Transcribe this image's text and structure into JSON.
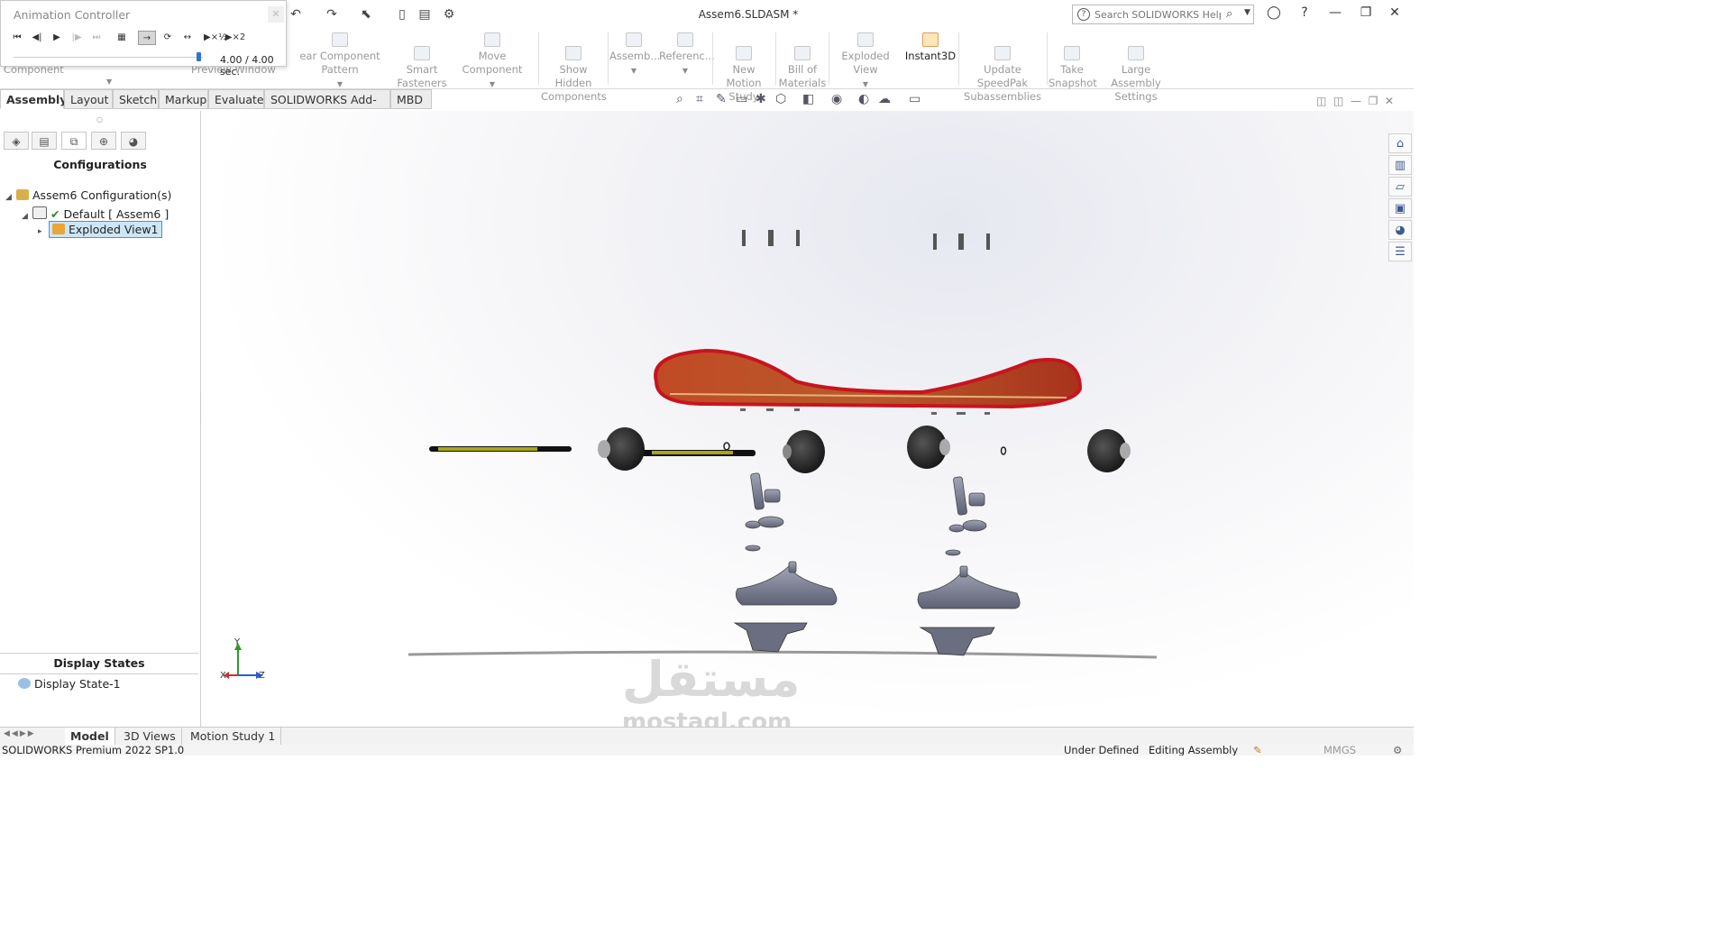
{
  "window": {
    "title": "Assem6.SLDASM *",
    "search_placeholder": "Search SOLIDWORKS Help"
  },
  "animation_controller": {
    "title": "Animation Controller",
    "time": "4.00 / 4.00 sec.",
    "speed_half": "▶×½",
    "speed_double": "▶×2",
    "progress": 1.0
  },
  "ribbon": {
    "partial_left": "Component",
    "preview_window": "Preview Window",
    "items": [
      {
        "label": "ear Component Pattern"
      },
      {
        "label": "Smart\nFasteners"
      },
      {
        "label": "Move Component"
      },
      {
        "label": "Show Hidden\nComponents"
      },
      {
        "label": "Assemb..."
      },
      {
        "label": "Referenc..."
      },
      {
        "label": "New Motion\nStudy"
      },
      {
        "label": "Bill of\nMaterials"
      },
      {
        "label": "Exploded View"
      },
      {
        "label": "Instant3D"
      },
      {
        "label": "Update SpeedPak\nSubassemblies"
      },
      {
        "label": "Take\nSnapshot"
      },
      {
        "label": "Large Assembly\nSettings"
      }
    ]
  },
  "tabs": [
    "Assembly",
    "Layout",
    "Sketch",
    "Markup",
    "Evaluate",
    "SOLIDWORKS Add-Ins",
    "MBD"
  ],
  "config_manager": {
    "header": "Configurations",
    "root": "Assem6 Configuration(s)",
    "default_config": "Default [ Assem6 ]",
    "exploded_view": "Exploded View1",
    "display_states_header": "Display States",
    "display_state": "Display State-1"
  },
  "triad": {
    "y": "Y",
    "z": "Z",
    "x": "X"
  },
  "bottom_tabs": [
    "Model",
    "3D Views",
    "Motion Study 1"
  ],
  "status_bar": {
    "left": "SOLIDWORKS Premium 2022 SP1.0",
    "state": "Under Defined",
    "mode": "Editing Assembly",
    "units": "MMGS"
  },
  "watermark": {
    "arabic": "مستقل",
    "latin": "mostaql.com"
  },
  "colors": {
    "deck_top": "#b3401f",
    "deck_edge": "#c8141e",
    "wheels": "#2a2a2a",
    "trucks": "#7b7f93",
    "axle": "#a6a61e",
    "selection": "#cde6f7"
  }
}
